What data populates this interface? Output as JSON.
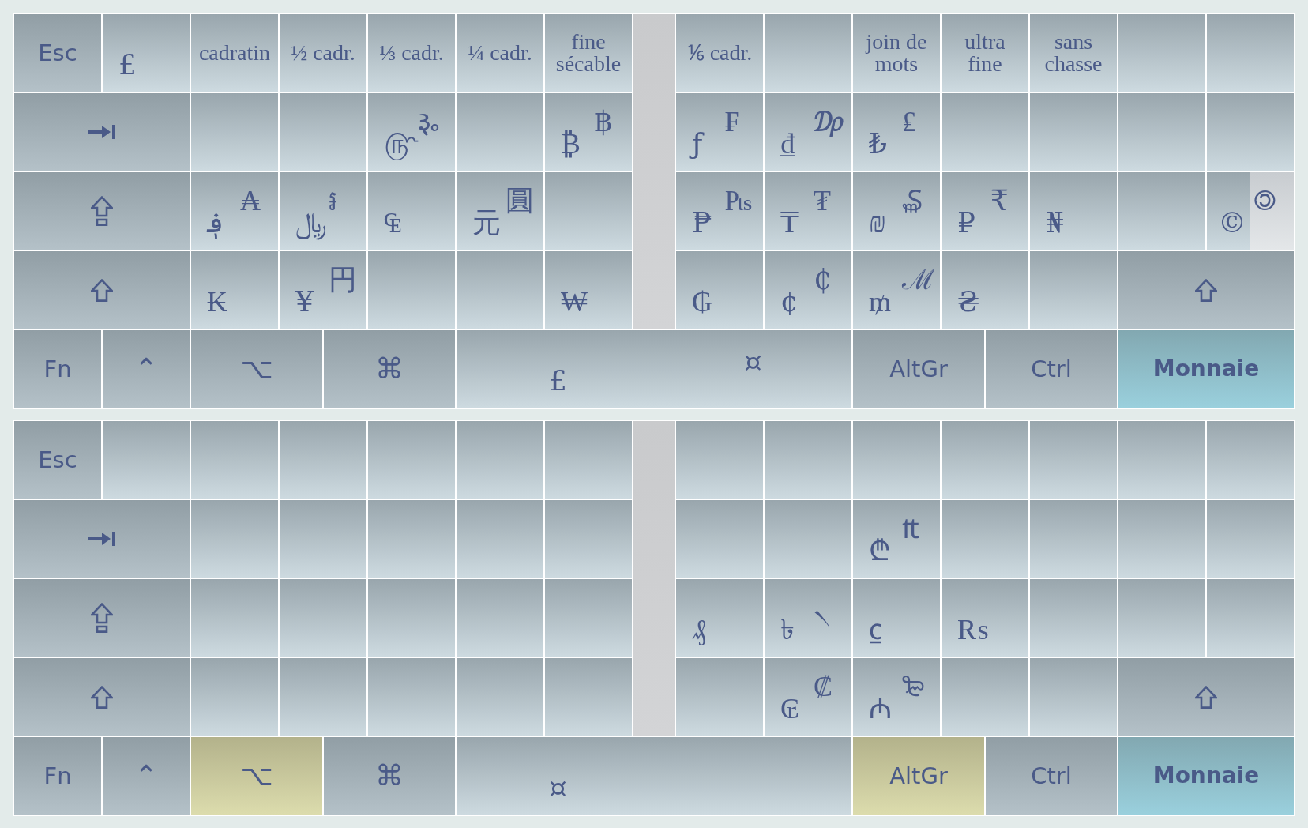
{
  "keyboards": [
    {
      "rows": [
        {
          "keys": [
            {
              "kind": "label",
              "label": "Esc",
              "active": false
            },
            {
              "kind": "char",
              "lower": "£"
            },
            {
              "kind": "name",
              "label": "cadratin"
            },
            {
              "kind": "name",
              "label": "½ cadr."
            },
            {
              "kind": "name",
              "label": "⅓ cadr."
            },
            {
              "kind": "name",
              "label": "¼ cadr."
            },
            {
              "kind": "name",
              "label": "fine sécable"
            },
            {
              "kind": "name",
              "label": "⅙ cadr."
            },
            {
              "kind": "char"
            },
            {
              "kind": "name",
              "label": "join de mots"
            },
            {
              "kind": "name",
              "label": "ultra fine"
            },
            {
              "kind": "name",
              "label": "sans chasse"
            },
            {
              "kind": "char"
            },
            {
              "kind": "char"
            }
          ]
        },
        {
          "keys": [
            {
              "kind": "tab",
              "active": false
            },
            {
              "kind": "char"
            },
            {
              "kind": "char"
            },
            {
              "kind": "char",
              "lower": "௹",
              "upper": "૱"
            },
            {
              "kind": "char"
            },
            {
              "kind": "char",
              "lower": "₿",
              "upper": "฿"
            },
            {
              "kind": "char",
              "lower": "ƒ",
              "upper": "₣"
            },
            {
              "kind": "char",
              "lower": "₫",
              "upper": "₯"
            },
            {
              "kind": "char",
              "lower": "₺",
              "upper": "₤"
            },
            {
              "kind": "char"
            },
            {
              "kind": "char"
            },
            {
              "kind": "char"
            },
            {
              "kind": "char"
            }
          ]
        },
        {
          "keys": [
            {
              "kind": "capslock",
              "active": false
            },
            {
              "kind": "char",
              "lower": "؋",
              "upper": "₳"
            },
            {
              "kind": "char",
              "lower": "﷼",
              "upper": "៛"
            },
            {
              "kind": "char",
              "lower": "₠"
            },
            {
              "kind": "char",
              "lower": "元",
              "upper": "圓"
            },
            {
              "kind": "char"
            },
            {
              "kind": "char",
              "lower": "₱",
              "upper": "₧"
            },
            {
              "kind": "char",
              "lower": "₸",
              "upper": "₮"
            },
            {
              "kind": "char",
              "lower": "₪",
              "upper": "₷"
            },
            {
              "kind": "char",
              "lower": "₽",
              "upper": "₹"
            },
            {
              "kind": "char",
              "lower": "₦"
            },
            {
              "kind": "char"
            },
            {
              "kind": "split",
              "lower": "©",
              "upper": "🄯"
            }
          ]
        },
        {
          "keys": [
            {
              "kind": "shift",
              "active": false
            },
            {
              "kind": "char",
              "lower": "₭"
            },
            {
              "kind": "char",
              "lower": "¥",
              "upper": "円"
            },
            {
              "kind": "char"
            },
            {
              "kind": "char"
            },
            {
              "kind": "char",
              "lower": "₩"
            },
            {
              "kind": "char",
              "lower": "₲"
            },
            {
              "kind": "char",
              "lower": "¢",
              "upper": "₵"
            },
            {
              "kind": "char",
              "lower": "₥",
              "upper": "ℳ"
            },
            {
              "kind": "char",
              "lower": "₴"
            },
            {
              "kind": "char"
            },
            {
              "kind": "shift",
              "active": false
            }
          ]
        },
        {
          "keys": [
            {
              "kind": "label",
              "label": "Fn",
              "active": false
            },
            {
              "kind": "symbol",
              "label": "⌃",
              "active": false
            },
            {
              "kind": "symbol",
              "label": "⌥",
              "active": false
            },
            {
              "kind": "symbol",
              "label": "⌘",
              "active": false
            },
            {
              "kind": "space",
              "lower": "£",
              "upper": "¤"
            },
            {
              "kind": "label",
              "label": "AltGr",
              "active": false
            },
            {
              "kind": "label",
              "label": "Ctrl",
              "active": false
            },
            {
              "kind": "dead",
              "label": "Monnaie"
            }
          ]
        }
      ]
    },
    {
      "rows": [
        {
          "keys": [
            {
              "kind": "label",
              "label": "Esc",
              "active": false
            },
            {
              "kind": "char"
            },
            {
              "kind": "char"
            },
            {
              "kind": "char"
            },
            {
              "kind": "char"
            },
            {
              "kind": "char"
            },
            {
              "kind": "char"
            },
            {
              "kind": "char"
            },
            {
              "kind": "char"
            },
            {
              "kind": "char"
            },
            {
              "kind": "char"
            },
            {
              "kind": "char"
            },
            {
              "kind": "char"
            },
            {
              "kind": "char"
            }
          ]
        },
        {
          "keys": [
            {
              "kind": "tab",
              "active": false
            },
            {
              "kind": "char"
            },
            {
              "kind": "char"
            },
            {
              "kind": "char"
            },
            {
              "kind": "char"
            },
            {
              "kind": "char"
            },
            {
              "kind": "char"
            },
            {
              "kind": "char"
            },
            {
              "kind": "char",
              "lower": "₾",
              "upper": "₶"
            },
            {
              "kind": "char"
            },
            {
              "kind": "char"
            },
            {
              "kind": "char"
            },
            {
              "kind": "char"
            }
          ]
        },
        {
          "keys": [
            {
              "kind": "capslock",
              "active": false
            },
            {
              "kind": "char"
            },
            {
              "kind": "char"
            },
            {
              "kind": "char"
            },
            {
              "kind": "char"
            },
            {
              "kind": "char"
            },
            {
              "kind": "char",
              "lower": "₰"
            },
            {
              "kind": "char",
              "lower": "৳",
              "upper": "৲"
            },
            {
              "kind": "char",
              "lower": "⃀"
            },
            {
              "kind": "char",
              "lower": "₨"
            },
            {
              "kind": "char"
            },
            {
              "kind": "char"
            },
            {
              "kind": "char"
            }
          ]
        },
        {
          "keys": [
            {
              "kind": "shift",
              "active": false
            },
            {
              "kind": "char"
            },
            {
              "kind": "char"
            },
            {
              "kind": "char"
            },
            {
              "kind": "char"
            },
            {
              "kind": "char"
            },
            {
              "kind": "char"
            },
            {
              "kind": "char",
              "lower": "₢",
              "upper": "₡"
            },
            {
              "kind": "char",
              "lower": "₼",
              "upper": "₻"
            },
            {
              "kind": "char"
            },
            {
              "kind": "char"
            },
            {
              "kind": "shift",
              "active": false
            }
          ]
        },
        {
          "keys": [
            {
              "kind": "label",
              "label": "Fn",
              "active": false
            },
            {
              "kind": "symbol",
              "label": "⌃",
              "active": false
            },
            {
              "kind": "symbol",
              "label": "⌥",
              "active": true
            },
            {
              "kind": "symbol",
              "label": "⌘",
              "active": false
            },
            {
              "kind": "space",
              "lower": "¤"
            },
            {
              "kind": "label",
              "label": "AltGr",
              "active": true
            },
            {
              "kind": "label",
              "label": "Ctrl",
              "active": false
            },
            {
              "kind": "dead",
              "label": "Monnaie"
            }
          ]
        }
      ]
    }
  ]
}
